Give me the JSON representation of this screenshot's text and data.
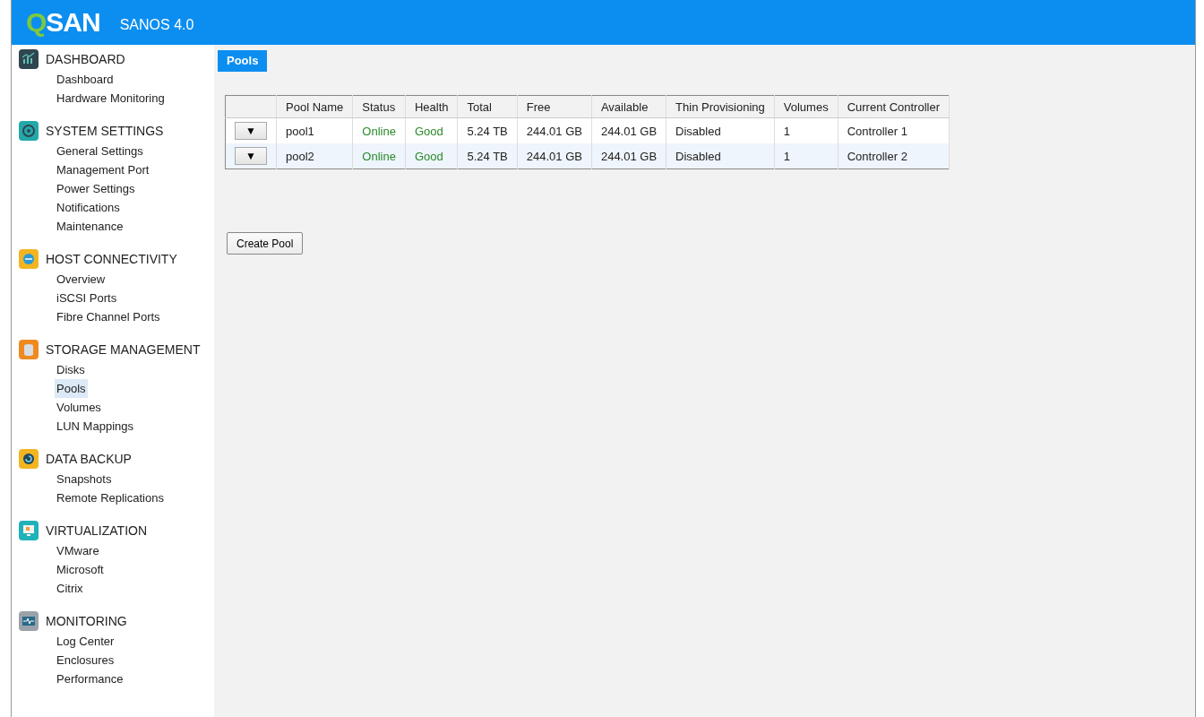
{
  "header": {
    "logo_accent": "Q",
    "logo_rest": "SAN",
    "product": "SANOS 4.0"
  },
  "sidebar": {
    "sections": [
      {
        "kind": "dashboard",
        "title": "DASHBOARD",
        "items": [
          {
            "label": "Dashboard",
            "selected": false
          },
          {
            "label": "Hardware Monitoring",
            "selected": false
          }
        ]
      },
      {
        "kind": "system",
        "title": "SYSTEM SETTINGS",
        "items": [
          {
            "label": "General Settings",
            "selected": false
          },
          {
            "label": "Management Port",
            "selected": false
          },
          {
            "label": "Power Settings",
            "selected": false
          },
          {
            "label": "Notifications",
            "selected": false
          },
          {
            "label": "Maintenance",
            "selected": false
          }
        ]
      },
      {
        "kind": "host",
        "title": "HOST CONNECTIVITY",
        "items": [
          {
            "label": "Overview",
            "selected": false
          },
          {
            "label": "iSCSI Ports",
            "selected": false
          },
          {
            "label": "Fibre Channel Ports",
            "selected": false
          }
        ]
      },
      {
        "kind": "storage",
        "title": "STORAGE MANAGEMENT",
        "items": [
          {
            "label": "Disks",
            "selected": false
          },
          {
            "label": "Pools",
            "selected": true
          },
          {
            "label": "Volumes",
            "selected": false
          },
          {
            "label": "LUN Mappings",
            "selected": false
          }
        ]
      },
      {
        "kind": "backup",
        "title": "DATA BACKUP",
        "items": [
          {
            "label": "Snapshots",
            "selected": false
          },
          {
            "label": "Remote Replications",
            "selected": false
          }
        ]
      },
      {
        "kind": "virtualization",
        "title": "VIRTUALIZATION",
        "items": [
          {
            "label": "VMware",
            "selected": false
          },
          {
            "label": "Microsoft",
            "selected": false
          },
          {
            "label": "Citrix",
            "selected": false
          }
        ]
      },
      {
        "kind": "monitoring",
        "title": "MONITORING",
        "items": [
          {
            "label": "Log Center",
            "selected": false
          },
          {
            "label": "Enclosures",
            "selected": false
          },
          {
            "label": "Performance",
            "selected": false
          }
        ]
      }
    ]
  },
  "tabs": [
    {
      "label": "Pools",
      "selected": true
    }
  ],
  "table": {
    "columns": [
      "Pool Name",
      "Status",
      "Health",
      "Total",
      "Free",
      "Available",
      "Thin Provisioning",
      "Volumes",
      "Current Controller"
    ],
    "rows": [
      {
        "menu": "▼",
        "cells": [
          "pool1",
          "Online",
          "Good",
          "5.24 TB",
          "244.01 GB",
          "244.01 GB",
          "Disabled",
          "1",
          "Controller 1"
        ]
      },
      {
        "menu": "▼",
        "cells": [
          "pool2",
          "Online",
          "Good",
          "5.24 TB",
          "244.01 GB",
          "244.01 GB",
          "Disabled",
          "1",
          "Controller 2"
        ]
      }
    ]
  },
  "buttons": [
    "Create Pool"
  ]
}
